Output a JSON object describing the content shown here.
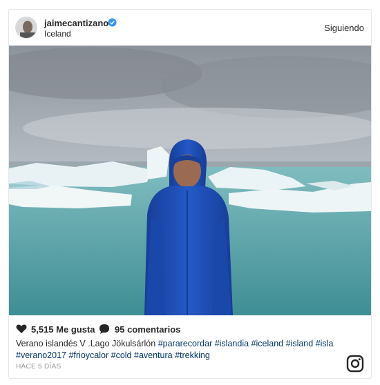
{
  "post": {
    "username": "jaimecantizano",
    "location": "Iceland",
    "follow_label": "Siguiendo",
    "likes": "5,515 Me gusta",
    "comments": "95 comentarios",
    "caption_text": "Verano islandés V .Lago Jökulsárlón",
    "hashtags": [
      "#pararecordar",
      "#islandia",
      "#iceland",
      "#island",
      "#isla",
      "#verano2017",
      "#frioycalor",
      "#cold",
      "#aventura",
      "#trekking"
    ],
    "timestamp": "HACE 5 DÍAS"
  },
  "icons": {
    "verified": "verified-badge-icon",
    "heart": "heart-icon",
    "comment": "comment-bubble-icon",
    "brand": "instagram-logo-icon"
  },
  "colors": {
    "verified_blue": "#3897f0",
    "hashtag": "#003569",
    "meta_gray": "#999999",
    "jacket": "#1f4fb8",
    "water": "#5fa8a8"
  }
}
